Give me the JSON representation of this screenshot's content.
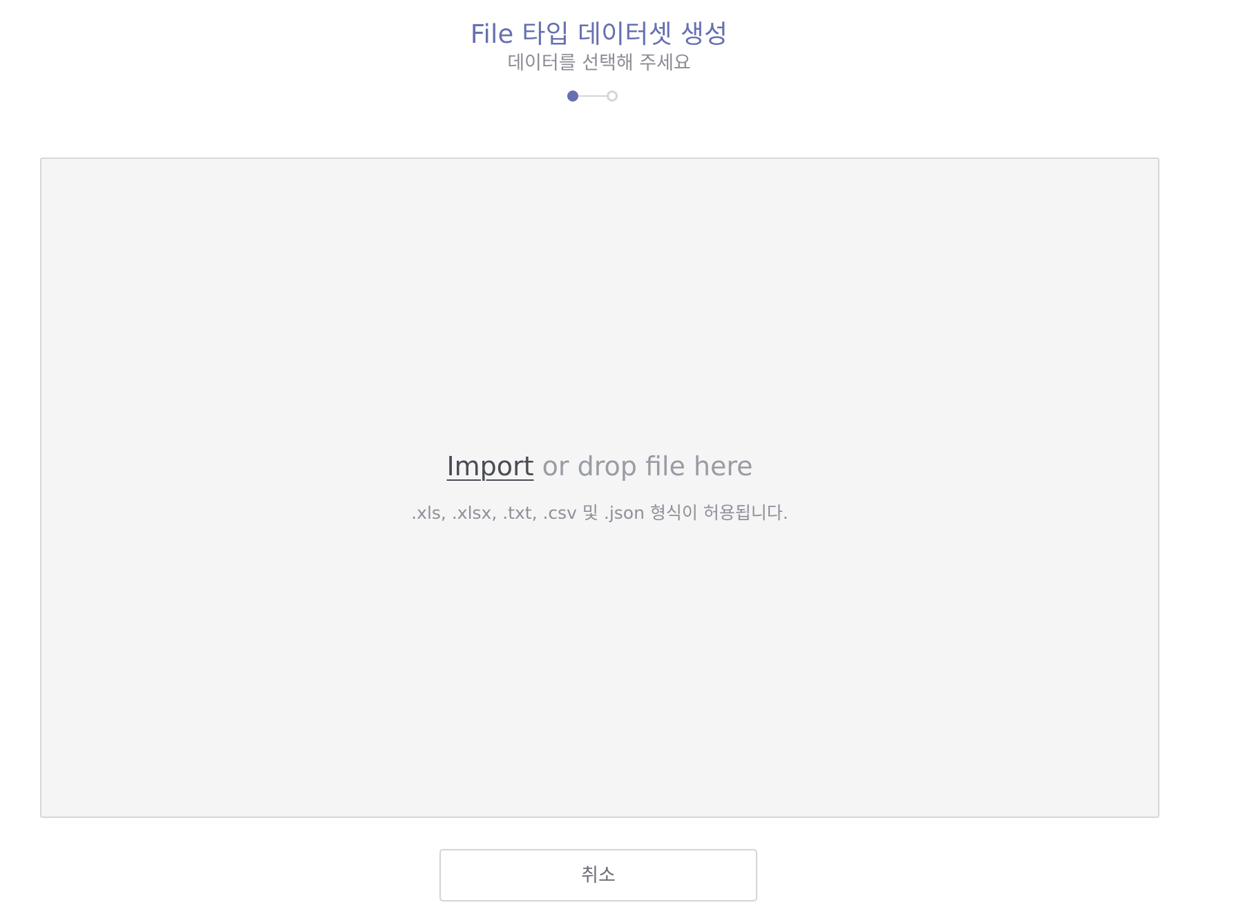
{
  "header": {
    "title": "File 타입 데이터셋 생성",
    "subtitle": "데이터를 선택해 주세요"
  },
  "stepper": {
    "current_step": 1,
    "total_steps": 2
  },
  "dropzone": {
    "import_label": "Import",
    "drop_text": " or drop file here",
    "hint": ".xls, .xlsx, .txt, .csv 및 .json 형식이 허용됩니다."
  },
  "actions": {
    "cancel_label": "취소"
  },
  "colors": {
    "accent": "#6670b0",
    "dropzone_background": "#f5f5f6",
    "muted_text": "#8a8d94"
  }
}
